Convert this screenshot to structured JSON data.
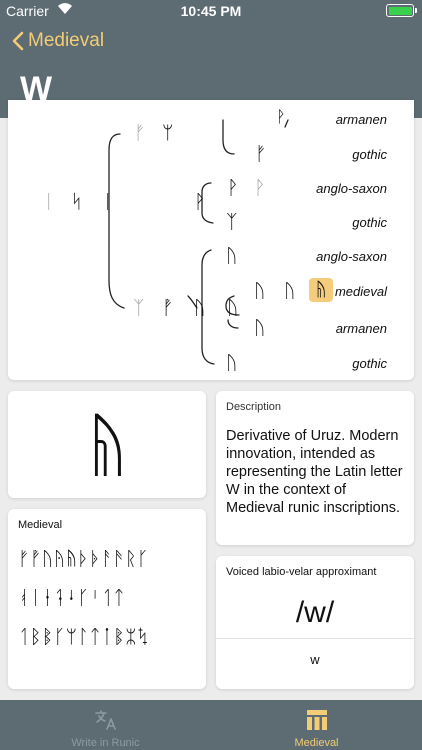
{
  "status": {
    "carrier": "Carrier",
    "time": "10:45 PM"
  },
  "nav": {
    "back_label": "Medieval",
    "title": "W"
  },
  "tree": {
    "top_rune_1": "ᚠ",
    "top_rune_2": "ᛘ",
    "root_runes": [
      "ᛁ",
      "ᛋ",
      "ᛁ"
    ],
    "mid_rune": "ᚹ",
    "armanen_top": "ᚹ",
    "gothic_top": "ᚠ",
    "anglo1_runes": [
      "ᚹ",
      "ᚹ"
    ],
    "gothic2_rune": "ᛉ",
    "anglo2_rune": "ᚢ",
    "y_chain": [
      "ᛉ",
      "ᚡ",
      "ᚢ"
    ],
    "branch_rune": "ᚢ",
    "medieval_chain": [
      "ᚢ",
      "ᚢ"
    ],
    "selected_rune": "ᚥ",
    "armanen2_rune": "ᚢ",
    "gothic3_rune": "ᚢ",
    "labels": {
      "armanen": "armanen",
      "gothic": "gothic",
      "anglo_saxon": "anglo-saxon",
      "medieval": "medieval"
    }
  },
  "big_rune": "ᚥ",
  "description": {
    "heading": "Description",
    "text": "Derivative of Uruz. Modern innovation, intended as representing the Latin letter W in the context of Medieval runic inscriptions."
  },
  "alphabet": {
    "heading": "Medieval",
    "rows": [
      "ᚠᚡᚢᚤᚥᚦᚧᚨᚫᚱᚴ",
      "ᚮᛁᛂᛑᛍᚴᛌᛐᛏ",
      "ᛐᛒᛔᚴᛘᛚᛏᛙᛔᛯᛪ"
    ]
  },
  "phonetic": {
    "heading": "Voiced labio-velar approximant",
    "ipa": "/w/",
    "latin": "w"
  },
  "tabs": [
    {
      "label": "Write in Runic"
    },
    {
      "label": "Medieval"
    }
  ],
  "colors": {
    "header": "#5d6b73",
    "accent": "#f2cd75",
    "highlight": "#f4cc7b"
  }
}
